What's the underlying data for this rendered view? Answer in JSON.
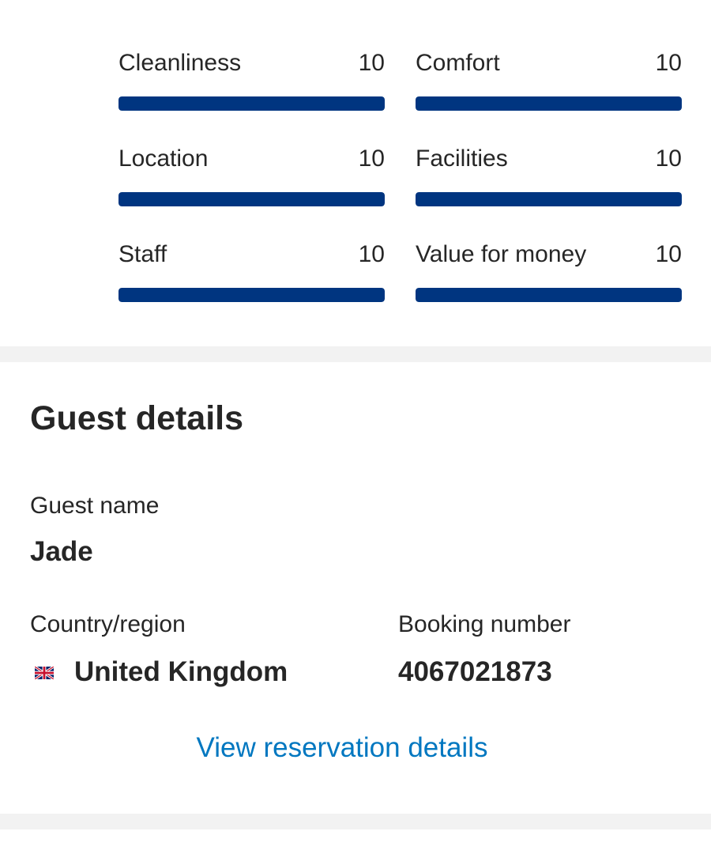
{
  "scores": [
    {
      "label": "Cleanliness",
      "value": "10",
      "fill": 1.0
    },
    {
      "label": "Comfort",
      "value": "10",
      "fill": 1.0
    },
    {
      "label": "Location",
      "value": "10",
      "fill": 1.0
    },
    {
      "label": "Facilities",
      "value": "10",
      "fill": 1.0
    },
    {
      "label": "Staff",
      "value": "10",
      "fill": 1.0
    },
    {
      "label": "Value for money",
      "value": "10",
      "fill": 1.0
    }
  ],
  "guest_details": {
    "title": "Guest details",
    "guest_name_label": "Guest name",
    "guest_name": "Jade",
    "country_label": "Country/region",
    "country": "United Kingdom",
    "country_flag_icon": "uk-flag-icon",
    "booking_label": "Booking number",
    "booking_number": "4067021873",
    "view_link": "View reservation details"
  },
  "colors": {
    "bar": "#003580",
    "link": "#0077c0",
    "divider": "#f2f2f2",
    "text": "#262626"
  }
}
